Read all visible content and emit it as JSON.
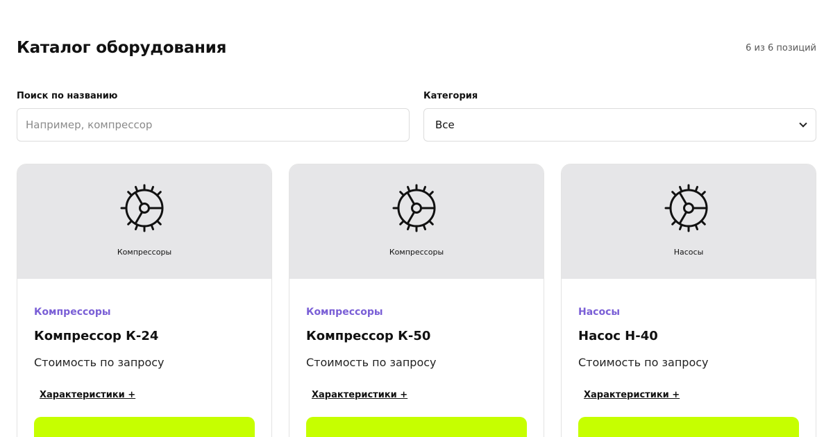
{
  "header": {
    "title": "Каталог оборудования",
    "count": "6 из 6 позиций"
  },
  "filters": {
    "search": {
      "label": "Поиск по названию",
      "placeholder": "Например, компрессор",
      "value": ""
    },
    "category": {
      "label": "Категория",
      "selected": "Все"
    }
  },
  "cards": [
    {
      "media_caption": "Компрессоры",
      "category": "Компрессоры",
      "title": "Компрессор К-24",
      "price": "Стоимость по запросу",
      "specs_label": "Характеристики +",
      "icon": "gear-icon"
    },
    {
      "media_caption": "Компрессоры",
      "category": "Компрессоры",
      "title": "Компрессор К-50",
      "price": "Стоимость по запросу",
      "specs_label": "Характеристики +",
      "icon": "gear-icon"
    },
    {
      "media_caption": "Насосы",
      "category": "Насосы",
      "title": "Насос Н-40",
      "price": "Стоимость по запросу",
      "specs_label": "Характеристики +",
      "icon": "gear-icon"
    }
  ],
  "colors": {
    "accent_category": "#7a5fd6",
    "cta_background": "#c6ff00",
    "media_background": "#e6e6e8"
  }
}
